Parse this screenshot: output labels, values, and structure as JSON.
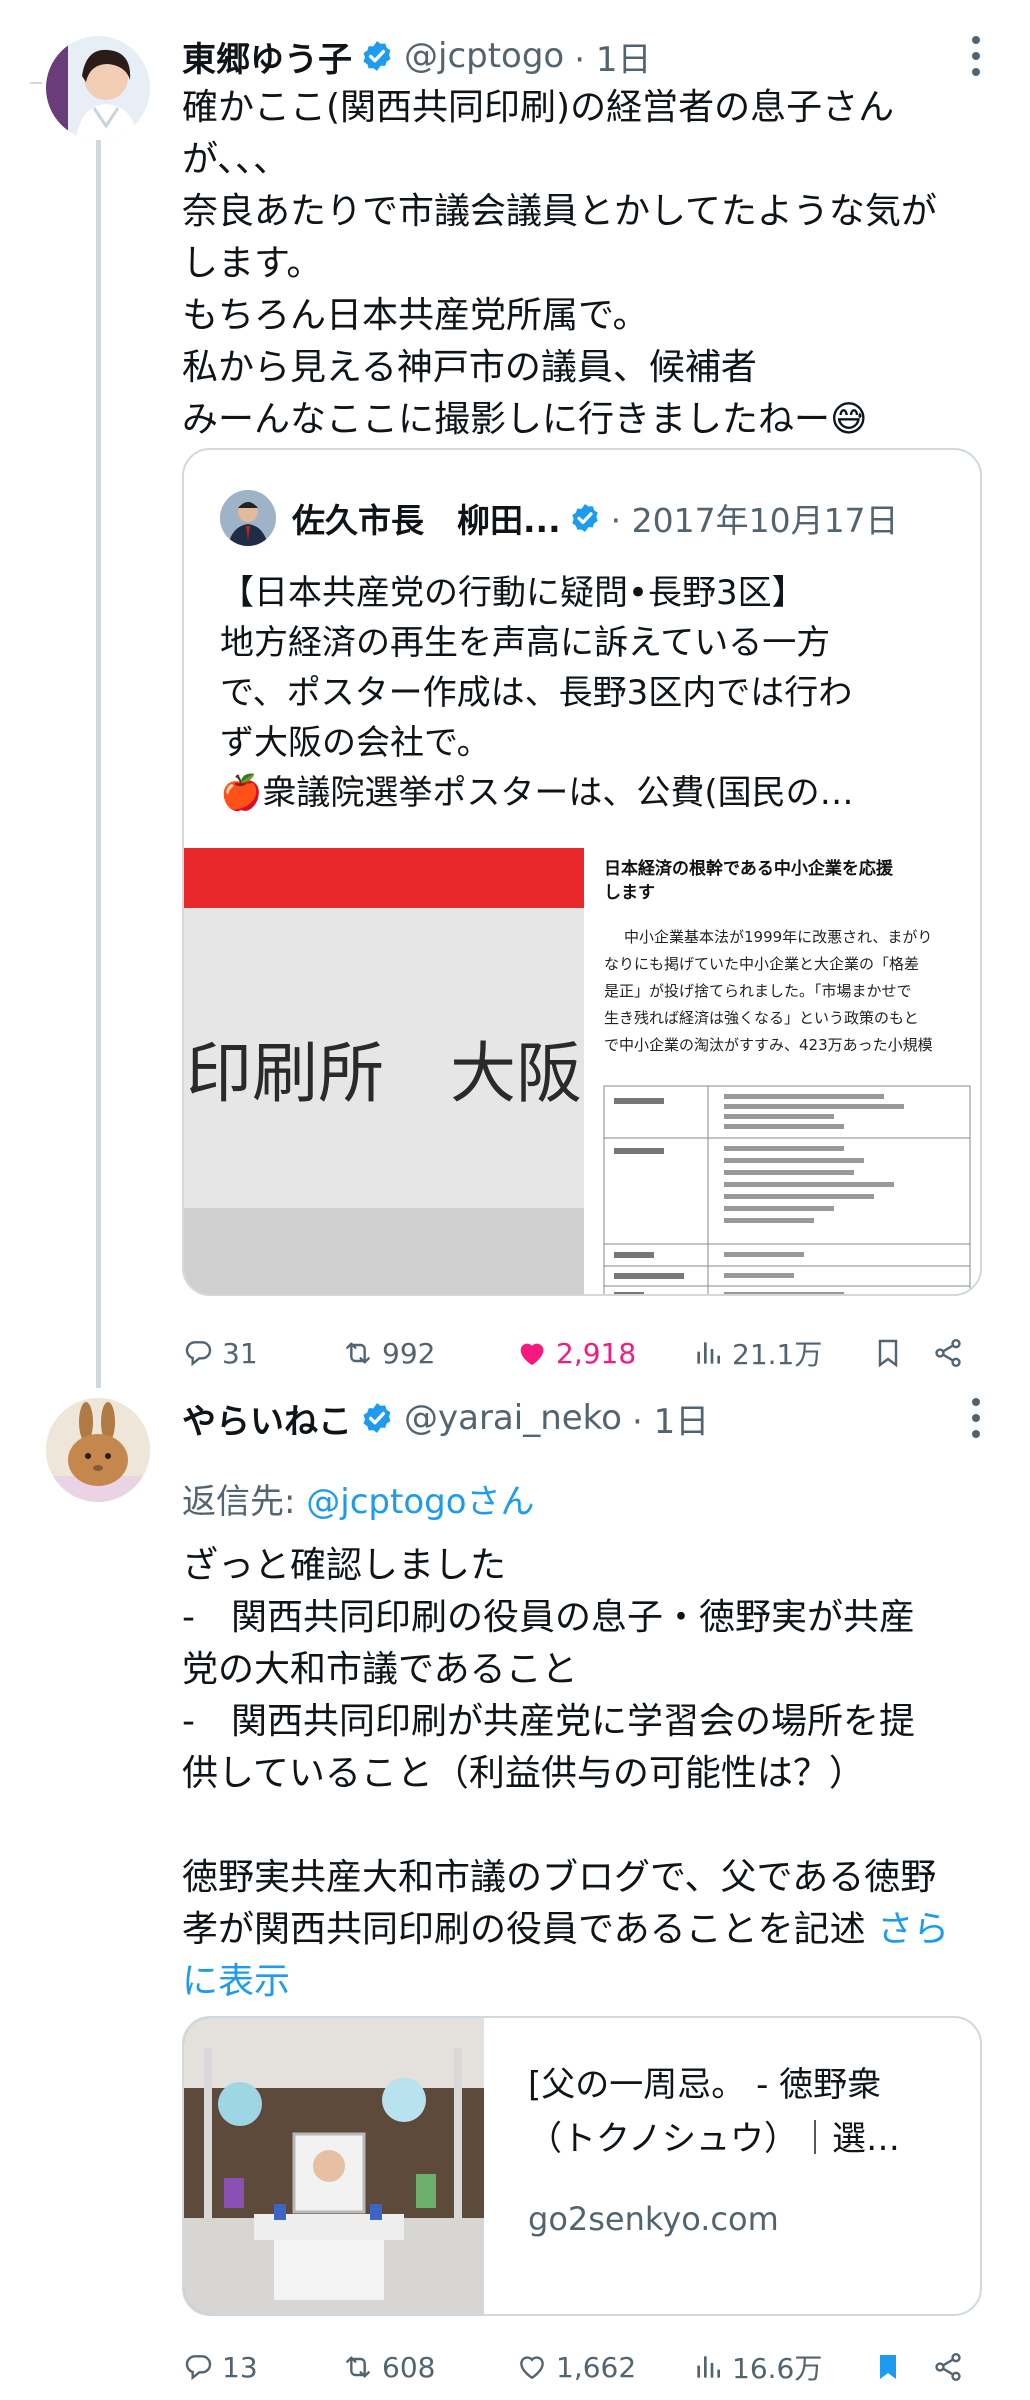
{
  "tweet1": {
    "name": "東郷ゆう子",
    "handle": "@jcptogo",
    "time": "· 1日",
    "text": "確かここ(関西共同印刷)の経営者の息子さん\nが､､､\n奈良あたりで市議会議員とかしてたような気が\nします。\nもちろん日本共産党所属で。\n私から見える神戸市の議員、候補者\nみーんなここに撮影しに行きましたねー😅",
    "quote": {
      "name": "佐久市長　柳田...",
      "time": "· 2017年10月17日",
      "text": "【日本共産党の行動に疑問•長野3区】\n地方経済の再生を声高に訴えている一方\nで、ポスター作成は、長野3区内では行わ\nず大阪の会社で。\n🍎衆議院選挙ポスターは、公費(国民の…",
      "image": {
        "big_text": "印刷所　大阪",
        "heading": "日本経済の根幹である中小企業を応援\nします",
        "paragraph": "中小企業基本法が1999年に改悪され、まがり\nなりにも掲げていた中小企業と大企業の「格差\n是正」が投げ捨てられました。「市場まかせで\n生き残れば経済は強くなる」という政策のもと\nで中小企業の淘汰がすすみ、423万あった小規模"
      }
    },
    "stats": {
      "replies": "31",
      "retweets": "992",
      "likes": "2,918",
      "views": "21.1万"
    },
    "colors": {
      "like": "#f91880"
    }
  },
  "tweet2": {
    "name": "やらいねこ",
    "handle": "@yarai_neko",
    "time": "· 1日",
    "reply_label": "返信先: ",
    "reply_target": "@jcptogoさん",
    "text": "ざっと確認しました\n-　関西共同印刷の役員の息子・徳野実が共産\n党の大和市議であること\n-　関西共同印刷が共産党に学習会の場所を提\n供していること（利益供与の可能性は？）\n\n徳野実共産大和市議のブログで、父である徳野\n孝が関西共同印刷の役員であることを記述 ",
    "show_more": "さら\nに表示",
    "link": {
      "title": "[父の一周忌。 - 徳野衆\n（トクノシュウ）｜選…",
      "domain": "go2senkyo.com"
    },
    "stats": {
      "replies": "13",
      "retweets": "608",
      "likes": "1,662",
      "views": "16.6万"
    },
    "colors": {
      "bookmark": "#1d9bf0"
    }
  },
  "colors": {
    "verified": "#1d9bf0",
    "link": "#1d9bf0",
    "muted": "#536471",
    "border": "#cfd9de"
  }
}
